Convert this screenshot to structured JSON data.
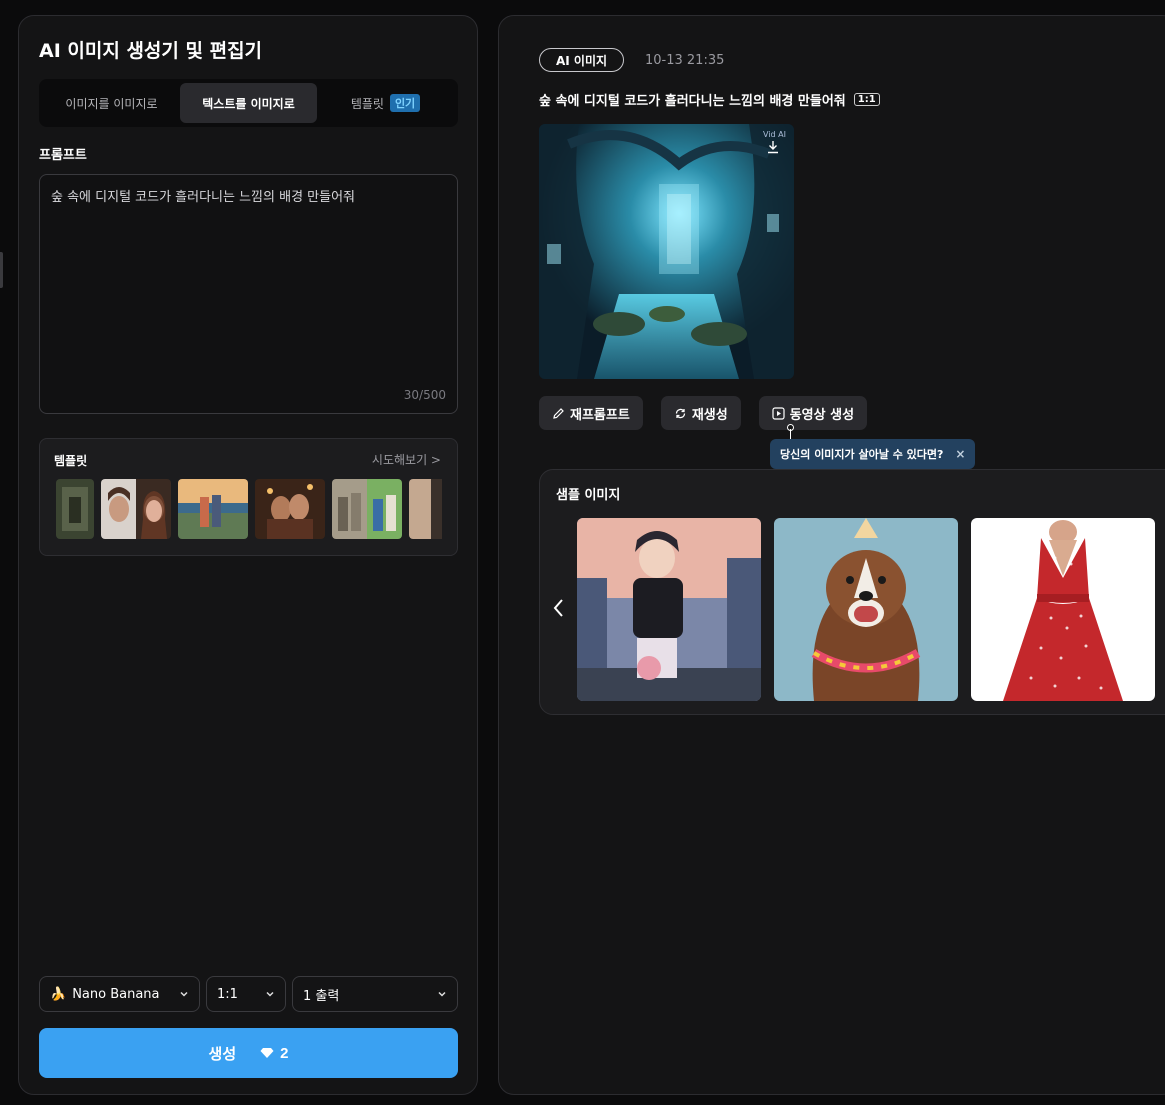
{
  "left": {
    "title": "AI 이미지 생성기 및 편집기",
    "tabs": [
      {
        "label": "이미지를 이미지로"
      },
      {
        "label": "텍스트를 이미지로"
      },
      {
        "label": "템플릿",
        "badge": "인기"
      }
    ],
    "prompt_label": "프롬프트",
    "prompt_value": "숲 속에 디지털 코드가 흘러다니는 느낌의 배경 만들어줘",
    "prompt_count": "30/500",
    "template_title": "템플릿",
    "template_more": "시도해보기 >",
    "model_select": "Nano Banana",
    "model_icon": "🍌",
    "ratio_select": "1:1",
    "output_select": "1 출력",
    "generate_label": "생성",
    "generate_cost": "2"
  },
  "right": {
    "tag": "AI 이미지",
    "time": "10-13 21:35",
    "prompt": "숲 속에 디지털 코드가 흘러다니는 느낌의 배경 만들어줘",
    "ratio": "1:1",
    "watermark": "Vid AI",
    "actions": [
      {
        "label": "재프롬프트"
      },
      {
        "label": "재생성"
      },
      {
        "label": "동영상 생성"
      }
    ],
    "tooltip": "당신의 이미지가 살아날 수 있다면?",
    "tooltip_close": "×",
    "samples_title": "샘플 이미지"
  },
  "colors": {
    "accent": "#3aa1f2",
    "panel_bg": "#141415",
    "badge_bg": "#1f6fae",
    "tooltip_bg": "#23415f"
  },
  "icons": [
    "pencil-icon",
    "refresh-icon",
    "video-icon",
    "download-icon",
    "chevron-down-icon",
    "chevron-left-icon",
    "diamond-icon",
    "close-icon"
  ]
}
